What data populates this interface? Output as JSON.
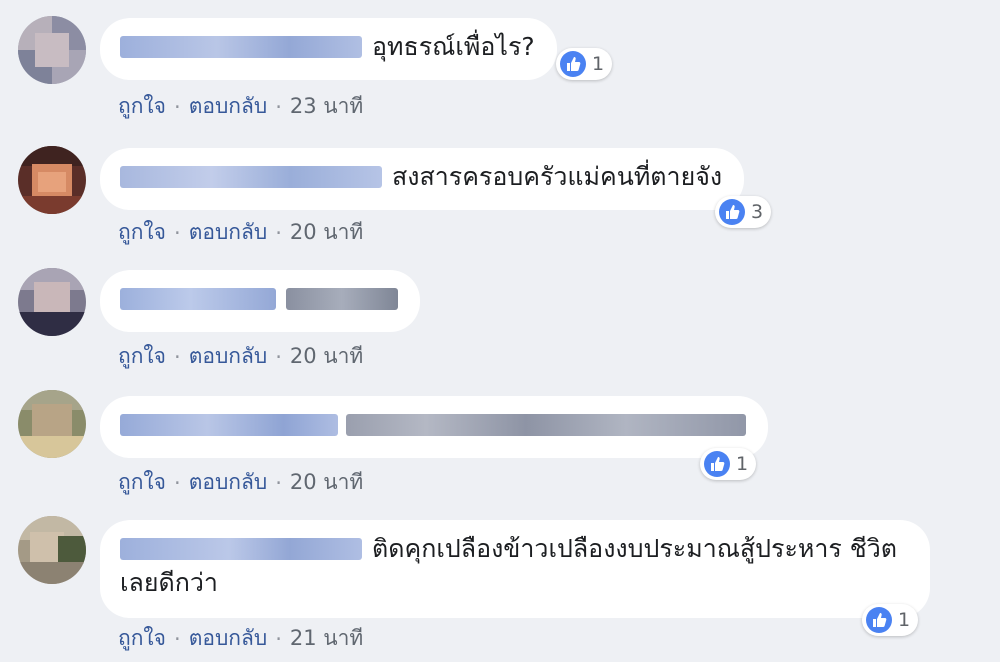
{
  "colors": {
    "background": "#eef0f4",
    "bubble": "#ffffff",
    "link": "#365899",
    "like_blue": "#4a82f2",
    "name_blur": "#8fa4d4"
  },
  "icons": {
    "reaction": "thumbs-up-icon"
  },
  "comments": [
    {
      "text": "อุทธรณ์เพื่อไร?",
      "reaction_count": "1",
      "like_label": "ถูกใจ",
      "reply_label": "ตอบกลับ",
      "separator": "·",
      "time": "23 นาที"
    },
    {
      "text": "สงสารครอบครัวแม่คนที่ตายจัง",
      "reaction_count": "3",
      "like_label": "ถูกใจ",
      "reply_label": "ตอบกลับ",
      "separator": "·",
      "time": "20 นาที"
    },
    {
      "text": "",
      "reaction_count": "",
      "like_label": "ถูกใจ",
      "reply_label": "ตอบกลับ",
      "separator": "·",
      "time": "20 นาที"
    },
    {
      "text": "",
      "reaction_count": "1",
      "like_label": "ถูกใจ",
      "reply_label": "ตอบกลับ",
      "separator": "·",
      "time": "20 นาที"
    },
    {
      "text": "ติดคุกเปลืองข้าวเปลืองงบประมาณสู้ประหาร ชีวิตเลยดีกว่า",
      "reaction_count": "1",
      "like_label": "ถูกใจ",
      "reply_label": "ตอบกลับ",
      "separator": "·",
      "time": "21 นาที"
    }
  ]
}
